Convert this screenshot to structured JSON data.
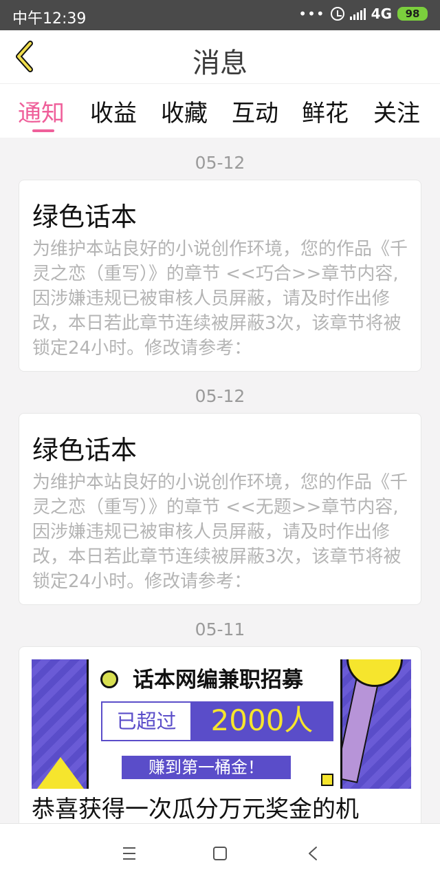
{
  "status": {
    "time": "中午12:39",
    "network": "4G",
    "battery": "98"
  },
  "header": {
    "title": "消息"
  },
  "tabs": [
    "通知",
    "收益",
    "收藏",
    "互动",
    "鲜花",
    "关注"
  ],
  "messages": [
    {
      "date": "05-12",
      "title": "绿色话本",
      "body": "为维护本站良好的小说创作环境，您的作品《千灵之恋（重写）》的章节 <<巧合>>章节内容,因涉嫌违规已被审核人员屏蔽，请及时作出修改，本日若此章节连续被屏蔽3次，该章节将被锁定24小时。修改请参考："
    },
    {
      "date": "05-12",
      "title": "绿色话本",
      "body": "为维护本站良好的小说创作环境，您的作品《千灵之恋（重写）》的章节 <<无题>>章节内容,因涉嫌违规已被审核人员屏蔽，请及时作出修改，本日若此章节连续被屏蔽3次，该章节将被锁定24小时。修改请参考："
    }
  ],
  "promo": {
    "date": "05-11",
    "headline": "话本网编兼职招募",
    "left_text": "已超过",
    "right_text": "2000人",
    "button_text": "赚到第一桶金！",
    "partial_title": "恭喜获得一次瓜分万元奖金的机"
  },
  "colors": {
    "accent": "#ef5f9a",
    "promo_purple": "#5a4dc9",
    "promo_yellow": "#f6e52d"
  },
  "icons": [
    "back-icon",
    "alarm-icon",
    "signal-icon",
    "battery-icon",
    "menu-icon",
    "home-icon",
    "nav-back-icon"
  ]
}
